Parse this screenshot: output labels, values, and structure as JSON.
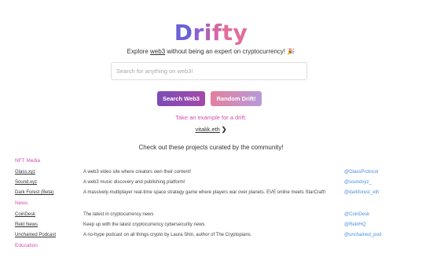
{
  "brand": {
    "logo_text": "Drifty",
    "logo_letters": [
      "D",
      "r",
      "i",
      "f",
      "t",
      "y"
    ],
    "colors": [
      "#6a62d6",
      "#8d60d4",
      "#b25fb8",
      "#d565a6",
      "#e26d9a"
    ]
  },
  "hero": {
    "tagline_prefix": "Explore ",
    "tagline_link": "web3",
    "tagline_suffix": " without being an expert on cryptocurrency! ",
    "tagline_emoji": "🎉"
  },
  "search": {
    "placeholder": "Search for anything on web3!",
    "value": ""
  },
  "buttons": {
    "search_label": "Search Web3",
    "random_label": "Random Drift!"
  },
  "example": {
    "label": "Take an example for a drift:",
    "link": "vitalik.eth",
    "chevron": "❯"
  },
  "community": {
    "heading": "Check out these projects curated by the community!"
  },
  "categories": [
    {
      "name": "NFT Media",
      "items": [
        {
          "name": "Glass.xyz",
          "description": "A web3 video site where creators own their content!",
          "handle": "@GlassProtocol"
        },
        {
          "name": "Sound.xyz",
          "description": "A web3 music discovery and publishing platform!",
          "handle": "@soundxyz_"
        },
        {
          "name": "Dark Forest (Beta)",
          "description": "A massively-multiplayer real-time space strategy game where players war over planets. EVE online meets StarCraft!",
          "handle": "@darkforest_eth"
        }
      ]
    },
    {
      "name": "News",
      "items": [
        {
          "name": "CoinDesk",
          "description": "The latest in cryptocurrency news",
          "handle": "@CoinDesk"
        },
        {
          "name": "Rekt News",
          "description": "Keep up with the latest cryptocurrency cybersecurity news",
          "handle": "@RektHQ"
        },
        {
          "name": "Unchained Podcast",
          "description": "A no-hype podcast on all things crypto by Laura Shin, author of The Cryptopians.",
          "handle": "@unchained_pod"
        }
      ]
    },
    {
      "name": "Education",
      "items": []
    }
  ]
}
